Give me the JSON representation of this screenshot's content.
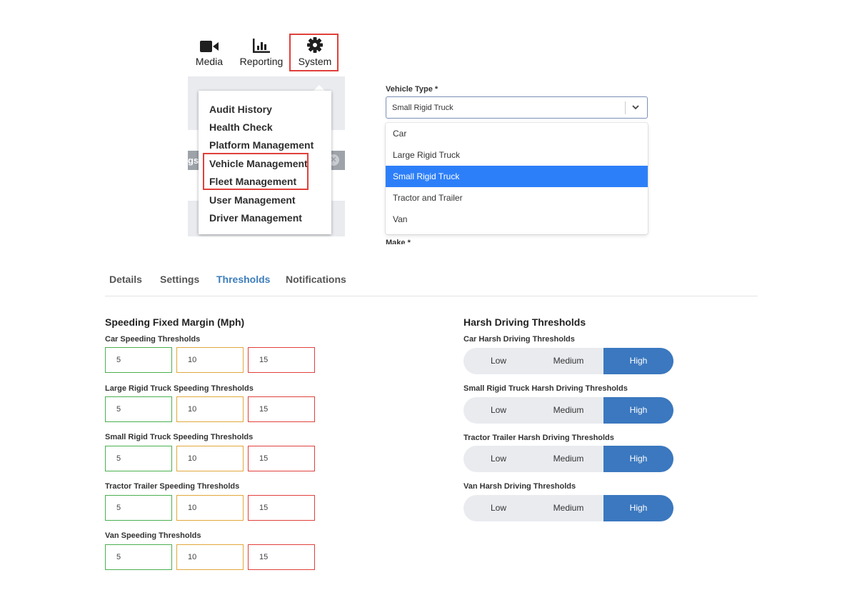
{
  "nav": {
    "items": [
      {
        "label": "Media",
        "icon": "video-camera-icon"
      },
      {
        "label": "Reporting",
        "icon": "bar-chart-icon"
      },
      {
        "label": "System",
        "icon": "gear-icon"
      }
    ]
  },
  "system_menu": {
    "items": [
      "Audit History",
      "Health Check",
      "Platform Management",
      "Vehicle Management",
      "Fleet Management",
      "User Management",
      "Driver Management"
    ],
    "background_fragment": "gs"
  },
  "vehicle_type": {
    "label": "Vehicle Type *",
    "selected": "Small Rigid Truck",
    "options": [
      "Car",
      "Large Rigid Truck",
      "Small Rigid Truck",
      "Tractor and Trailer",
      "Van"
    ],
    "next_label": "Make *"
  },
  "tabs": [
    {
      "label": "Details",
      "active": false
    },
    {
      "label": "Settings",
      "active": false
    },
    {
      "label": "Thresholds",
      "active": true
    },
    {
      "label": "Notifications",
      "active": false
    }
  ],
  "speeding": {
    "title": "Speeding Fixed Margin (Mph)",
    "rows": [
      {
        "label": "Car Speeding Thresholds",
        "values": [
          "5",
          "10",
          "15"
        ]
      },
      {
        "label": "Large Rigid Truck Speeding Thresholds",
        "values": [
          "5",
          "10",
          "15"
        ]
      },
      {
        "label": "Small Rigid Truck Speeding Thresholds",
        "values": [
          "5",
          "10",
          "15"
        ]
      },
      {
        "label": "Tractor Trailer Speeding Thresholds",
        "values": [
          "5",
          "10",
          "15"
        ]
      },
      {
        "label": "Van Speeding Thresholds",
        "values": [
          "5",
          "10",
          "15"
        ]
      }
    ]
  },
  "harsh": {
    "title": "Harsh Driving Thresholds",
    "options": [
      "Low",
      "Medium",
      "High"
    ],
    "rows": [
      {
        "label": "Car Harsh Driving Thresholds",
        "selected": "High"
      },
      {
        "label": "Small Rigid Truck Harsh Driving Thresholds",
        "selected": "High"
      },
      {
        "label": "Tractor Trailer Harsh Driving Thresholds",
        "selected": "High"
      },
      {
        "label": "Van Harsh Driving Thresholds",
        "selected": "High"
      }
    ]
  },
  "colors": {
    "highlight": "#e0403c",
    "select_blue": "#2d7ff9",
    "segment_active": "#3b78bf",
    "tab_active": "#3d7dbb",
    "low_threshold": "#4caf50",
    "mid_threshold": "#e0a83d",
    "high_threshold": "#e0403c"
  }
}
